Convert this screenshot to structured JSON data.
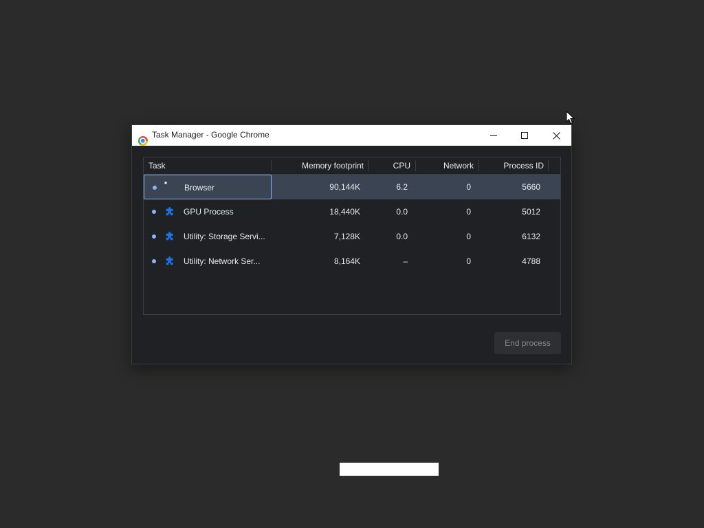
{
  "window": {
    "title": "Task Manager - Google Chrome"
  },
  "table": {
    "columns": [
      "Task",
      "Memory footprint",
      "CPU",
      "Network",
      "Process ID"
    ],
    "rows": [
      {
        "task": "Browser",
        "icon": "chrome-icon",
        "memory": "90,144K",
        "cpu": "6.2",
        "network": "0",
        "pid": "5660",
        "selected": true
      },
      {
        "task": "GPU Process",
        "icon": "puzzle-icon",
        "memory": "18,440K",
        "cpu": "0.0",
        "network": "0",
        "pid": "5012",
        "selected": false
      },
      {
        "task": "Utility: Storage Servi...",
        "icon": "puzzle-icon",
        "memory": "7,128K",
        "cpu": "0.0",
        "network": "0",
        "pid": "6132",
        "selected": false
      },
      {
        "task": "Utility: Network Ser...",
        "icon": "puzzle-icon",
        "memory": "8,164K",
        "cpu": "–",
        "network": "0",
        "pid": "4788",
        "selected": false
      }
    ]
  },
  "buttons": {
    "end_process": "End process"
  },
  "colors": {
    "window_bg": "#202124",
    "selected_row": "#3b4453",
    "accent": "#8ab4f8",
    "puzzle_blue": "#1a73e8"
  }
}
